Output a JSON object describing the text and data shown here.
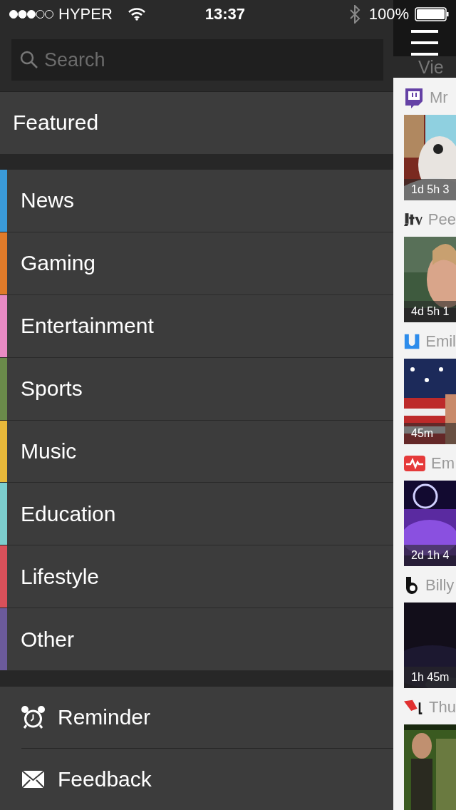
{
  "status_bar": {
    "carrier": "HYPER",
    "time": "13:37",
    "battery": "100%"
  },
  "search": {
    "placeholder": "Search"
  },
  "featured": {
    "label": "Featured"
  },
  "categories": [
    {
      "label": "News",
      "color": "#3a9ad9"
    },
    {
      "label": "Gaming",
      "color": "#e07b2a"
    },
    {
      "label": "Entertainment",
      "color": "#e88bc4"
    },
    {
      "label": "Sports",
      "color": "#6a8a4a"
    },
    {
      "label": "Music",
      "color": "#e8b83a"
    },
    {
      "label": "Education",
      "color": "#7ccdcd"
    },
    {
      "label": "Lifestyle",
      "color": "#d9505a"
    },
    {
      "label": "Other",
      "color": "#6b5a9a"
    }
  ],
  "footer_items": [
    {
      "kind": "alarm",
      "label": "Reminder"
    },
    {
      "kind": "mail",
      "label": "Feedback"
    }
  ],
  "feed": {
    "header": "Vie",
    "cards": [
      {
        "source": {
          "kind": "twitch"
        },
        "name": "Mr",
        "duration": "1d 5h 3"
      },
      {
        "source": {
          "kind": "jtv"
        },
        "name": "Pee",
        "duration": "4d 5h 1"
      },
      {
        "source": {
          "kind": "ustream"
        },
        "name": "Emil",
        "duration": "45m"
      },
      {
        "source": {
          "kind": "wave"
        },
        "name": "Em",
        "duration": "2d 1h 4"
      },
      {
        "source": {
          "kind": "b"
        },
        "name": "Billy",
        "duration": "1h 45m"
      },
      {
        "source": {
          "kind": "red"
        },
        "name": "Thu"
      }
    ]
  }
}
